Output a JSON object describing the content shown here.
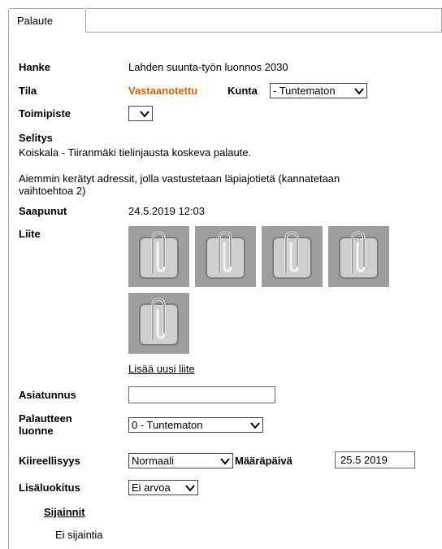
{
  "tab": {
    "label": "Palaute"
  },
  "hanke": {
    "label": "Hanke",
    "value": "Lahden suunta-työn luonnos 2030"
  },
  "tila": {
    "label": "Tila",
    "value": "Vastaanotettu"
  },
  "kunta": {
    "label": "Kunta",
    "value": "- Tuntematon"
  },
  "toimipiste": {
    "label": "Toimipiste",
    "value": ""
  },
  "selitys": {
    "label": "Selitys",
    "text1": "Koiskala - Tiiranmäki tielinjausta koskeva palaute.",
    "text2a": "Aiemmin kerätyt adressit, jolla vastustetaan läpiajotietä (kannatetaan",
    "text2b": "vaihtoehtoa 2)"
  },
  "saapunut": {
    "label": "Saapunut",
    "value": "24.5.2019 12:03"
  },
  "liite": {
    "label": "Liite",
    "add_link": "Lisää uusi liite",
    "thumbnail_icon": "paperclip-icon"
  },
  "asiatunnus": {
    "label": "Asiatunnus",
    "value": ""
  },
  "palautteen_luonne": {
    "label1": "Palautteen",
    "label2": "luonne",
    "value": "0 - Tuntematon"
  },
  "kiireellisyys": {
    "label": "Kiireellisyys",
    "value": "Normaali"
  },
  "maarapaiva": {
    "label": "Määräpäivä",
    "value": "25.5 2019"
  },
  "lisaluokitus": {
    "label": "Lisäluokitus",
    "value": "Ei arvoa"
  },
  "sijainnit": {
    "label": "Sijainnit",
    "empty_text": "Ei sijaintia"
  },
  "colors": {
    "tila_status": "#cc6600",
    "border": "#9ca6b8",
    "thumbnail_bg": "#9e9e9e"
  }
}
